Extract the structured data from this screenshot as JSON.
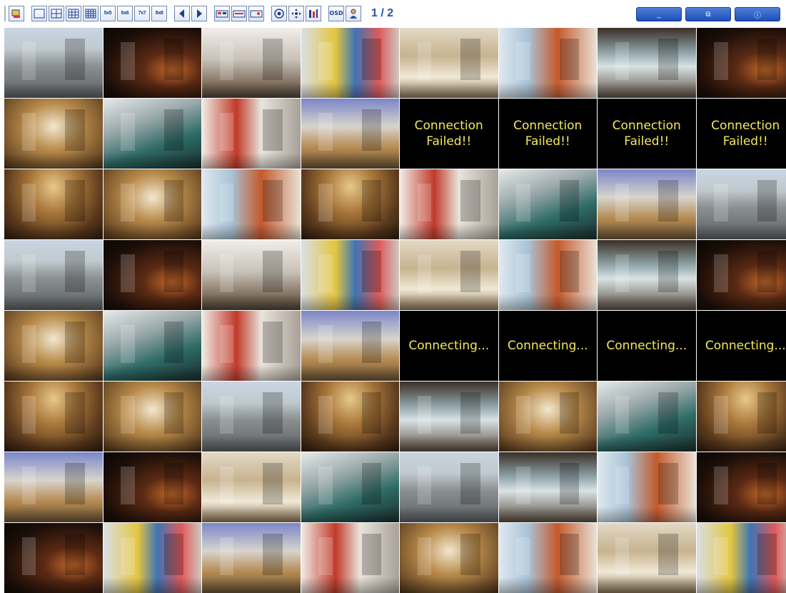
{
  "toolbar": {
    "layout_buttons": [
      {
        "label": ""
      },
      {
        "label": ""
      },
      {
        "label": ""
      },
      {
        "label": ""
      },
      {
        "label": "5x5"
      },
      {
        "label": "6x6"
      },
      {
        "label": "7x7"
      },
      {
        "label": "8x8"
      }
    ],
    "osd_label": "OSD",
    "page_indicator": "1 / 2"
  },
  "window_buttons": {
    "minimize": "_",
    "restore": "⧉",
    "info": "ⓘ"
  },
  "colors": {
    "selected_border": "#39d13c",
    "status_text": "#f2e95a",
    "accent_blue": "#2a51a8"
  },
  "grid": {
    "rows": 8,
    "cols": 8,
    "cells": [
      {
        "scene": "street",
        "status": "",
        "selected": true
      },
      {
        "scene": "dark",
        "status": ""
      },
      {
        "scene": "office",
        "status": ""
      },
      {
        "scene": "colorful",
        "status": ""
      },
      {
        "scene": "floor",
        "status": ""
      },
      {
        "scene": "atrium",
        "status": ""
      },
      {
        "scene": "windows",
        "status": ""
      },
      {
        "scene": "dark",
        "status": ""
      },
      {
        "scene": "corridor",
        "status": ""
      },
      {
        "scene": "stairs",
        "status": ""
      },
      {
        "scene": "red",
        "status": ""
      },
      {
        "scene": "reception",
        "status": ""
      },
      {
        "scene": "none",
        "status": "Connection\nFailed!!"
      },
      {
        "scene": "none",
        "status": "Connection\nFailed!!"
      },
      {
        "scene": "none",
        "status": "Connection\nFailed!!"
      },
      {
        "scene": "none",
        "status": "Connection\nFailed!!"
      },
      {
        "scene": "lobby",
        "status": ""
      },
      {
        "scene": "corridor",
        "status": ""
      },
      {
        "scene": "atrium",
        "status": ""
      },
      {
        "scene": "lobby",
        "status": ""
      },
      {
        "scene": "red",
        "status": ""
      },
      {
        "scene": "stairs",
        "status": ""
      },
      {
        "scene": "reception",
        "status": ""
      },
      {
        "scene": "street",
        "status": ""
      },
      {
        "scene": "street",
        "status": ""
      },
      {
        "scene": "dark",
        "status": ""
      },
      {
        "scene": "office",
        "status": ""
      },
      {
        "scene": "colorful",
        "status": ""
      },
      {
        "scene": "floor",
        "status": ""
      },
      {
        "scene": "atrium",
        "status": ""
      },
      {
        "scene": "windows",
        "status": ""
      },
      {
        "scene": "dark",
        "status": ""
      },
      {
        "scene": "corridor",
        "status": ""
      },
      {
        "scene": "stairs",
        "status": ""
      },
      {
        "scene": "red",
        "status": ""
      },
      {
        "scene": "reception",
        "status": ""
      },
      {
        "scene": "none",
        "status": "Connecting..."
      },
      {
        "scene": "none",
        "status": "Connecting..."
      },
      {
        "scene": "none",
        "status": "Connecting..."
      },
      {
        "scene": "none",
        "status": "Connecting..."
      },
      {
        "scene": "lobby",
        "status": ""
      },
      {
        "scene": "corridor",
        "status": ""
      },
      {
        "scene": "street",
        "status": ""
      },
      {
        "scene": "lobby",
        "status": ""
      },
      {
        "scene": "windows",
        "status": ""
      },
      {
        "scene": "corridor",
        "status": ""
      },
      {
        "scene": "stairs",
        "status": ""
      },
      {
        "scene": "lobby",
        "status": ""
      },
      {
        "scene": "reception",
        "status": ""
      },
      {
        "scene": "dark",
        "status": ""
      },
      {
        "scene": "floor",
        "status": ""
      },
      {
        "scene": "stairs",
        "status": ""
      },
      {
        "scene": "street",
        "status": ""
      },
      {
        "scene": "windows",
        "status": ""
      },
      {
        "scene": "atrium",
        "status": ""
      },
      {
        "scene": "dark",
        "status": ""
      },
      {
        "scene": "dark",
        "status": ""
      },
      {
        "scene": "colorful",
        "status": ""
      },
      {
        "scene": "reception",
        "status": ""
      },
      {
        "scene": "red",
        "status": ""
      },
      {
        "scene": "corridor",
        "status": ""
      },
      {
        "scene": "atrium",
        "status": ""
      },
      {
        "scene": "floor",
        "status": ""
      },
      {
        "scene": "colorful",
        "status": ""
      }
    ]
  }
}
